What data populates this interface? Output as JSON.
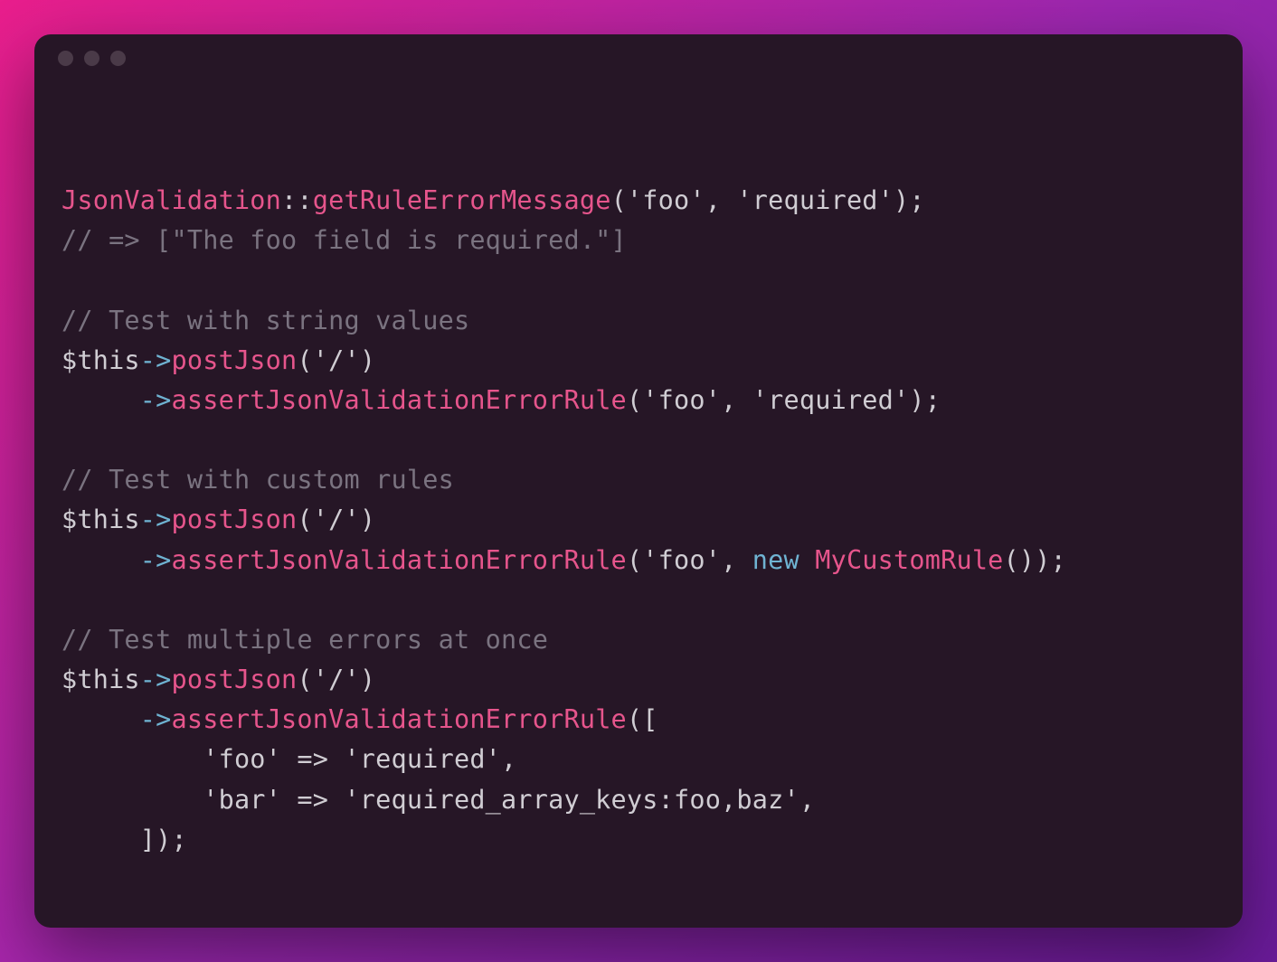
{
  "window": {
    "dots": [
      "dim",
      "dim",
      "dim"
    ]
  },
  "code": {
    "l1": {
      "cls": "JsonValidation",
      "dcolon": "::",
      "fn": "getRuleErrorMessage",
      "op": "(",
      "s1": "'foo'",
      "c": ", ",
      "s2": "'required'",
      "cl": ");"
    },
    "l2": "// => [\"The foo field is required.\"]",
    "l3": "",
    "l4": "// Test with string values",
    "l5": {
      "var": "$this",
      "ar": "->",
      "fn": "postJson",
      "op": "(",
      "s1": "'/'",
      "cl": ")"
    },
    "l6": {
      "indent": "     ",
      "ar": "->",
      "fn": "assertJsonValidationErrorRule",
      "op": "(",
      "s1": "'foo'",
      "c": ", ",
      "s2": "'required'",
      "cl": ");"
    },
    "l7": "",
    "l8": "// Test with custom rules",
    "l9": {
      "var": "$this",
      "ar": "->",
      "fn": "postJson",
      "op": "(",
      "s1": "'/'",
      "cl": ")"
    },
    "l10": {
      "indent": "     ",
      "ar": "->",
      "fn": "assertJsonValidationErrorRule",
      "op": "(",
      "s1": "'foo'",
      "c": ", ",
      "kw": "new",
      "sp": " ",
      "cls": "MyCustomRule",
      "pp": "()",
      "cl": ");"
    },
    "l11": "",
    "l12": "// Test multiple errors at once",
    "l13": {
      "var": "$this",
      "ar": "->",
      "fn": "postJson",
      "op": "(",
      "s1": "'/'",
      "cl": ")"
    },
    "l14": {
      "indent": "     ",
      "ar": "->",
      "fn": "assertJsonValidationErrorRule",
      "op": "(["
    },
    "l15": "         'foo' => 'required',",
    "l16": "         'bar' => 'required_array_keys:foo,baz',",
    "l17": "     ]);"
  }
}
